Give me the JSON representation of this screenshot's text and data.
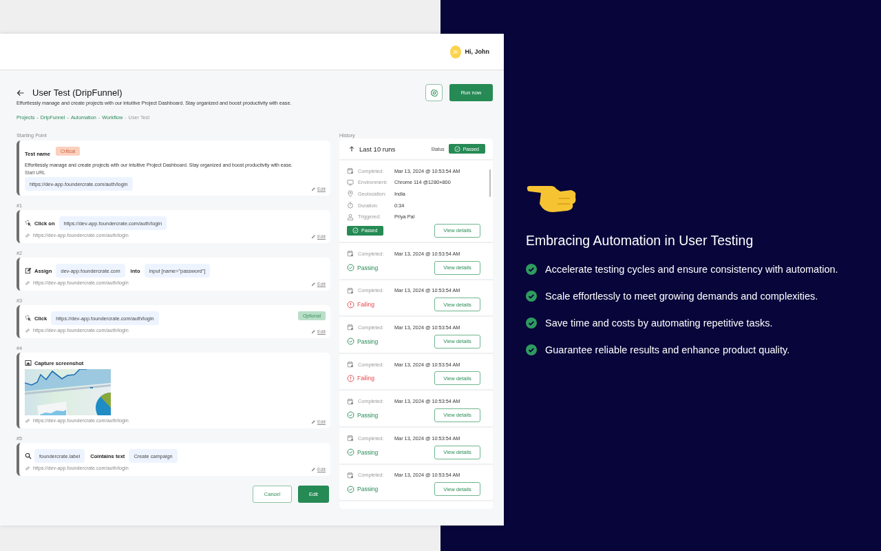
{
  "header": {
    "avatar_initials": "JK",
    "greeting": "Hi, John"
  },
  "page": {
    "title": "User Test (DripFunnel)",
    "description": "Effortlessly manage and create projects with our intuitive Project Dashboard. Stay organized and boost productivity with ease.",
    "separator": "-",
    "breadcrumb": [
      {
        "label": "Projects",
        "link": true
      },
      {
        "label": "DripFunnel",
        "link": true
      },
      {
        "label": "Automation",
        "link": true
      },
      {
        "label": "Workflow",
        "link": true
      },
      {
        "label": "User Test",
        "link": false
      }
    ],
    "run_button": "Run now"
  },
  "starting_point": {
    "heading": "Starting Point",
    "name_label": "Test name",
    "badge": {
      "text": "Critical",
      "kind": "critical"
    },
    "description": "Effortlessly manage and create projects with our intuitive Project Dashboard. Stay organized and boost productivity with ease.",
    "url_label": "Start URL",
    "url": "https://dev-app.foundercrate.com/auth/login",
    "edit": "Edit"
  },
  "steps": [
    {
      "number": "#1",
      "kind": "click",
      "parts": [
        {
          "kind": "label",
          "text": "Click on"
        },
        {
          "kind": "chip",
          "text": "https://dev-app.foundercrate.com/auth/login"
        }
      ],
      "link": "https://dev-app.foundercrate.com/auth/login",
      "edit": "Edit"
    },
    {
      "number": "#2",
      "kind": "assign",
      "parts": [
        {
          "kind": "label",
          "text": "Assign"
        },
        {
          "kind": "chip",
          "text": "dev-app.foundercrate.com"
        },
        {
          "kind": "label",
          "text": "into"
        },
        {
          "kind": "chip",
          "text": "input [name=\"password\"]"
        }
      ],
      "link": "https://dev-app.foundercrate.com/auth/login",
      "edit": "Edit"
    },
    {
      "number": "#3",
      "kind": "click",
      "parts": [
        {
          "kind": "label",
          "text": "Click"
        },
        {
          "kind": "chip",
          "text": "https://dev-app.foundercrate.com/auth/login"
        }
      ],
      "badge": {
        "text": "Optional",
        "kind": "optional"
      },
      "link": "https://dev-app.foundercrate.com/auth/login",
      "edit": "Edit"
    },
    {
      "number": "#4",
      "kind": "screenshot",
      "parts": [
        {
          "kind": "label",
          "text": "Capture screenshot"
        }
      ],
      "screenshot": {
        "kind": "picture"
      },
      "link": "https://dev-app.foundercrate.com/auth/login",
      "edit": "Edit"
    },
    {
      "number": "#5",
      "kind": "find",
      "parts": [
        {
          "kind": "chip",
          "text": "foundercrate.label"
        },
        {
          "kind": "label",
          "text": "Cointains text"
        },
        {
          "kind": "chip",
          "text": "Create campaign"
        }
      ],
      "link": "https://dev-app.foundercrate.com/auth/login",
      "edit": "Edit"
    }
  ],
  "actions": {
    "cancel": "Cancel",
    "submit": "Edit"
  },
  "history": {
    "heading": "History",
    "title": "Last 10 runs",
    "status_label": "Status",
    "status": {
      "text": "Passed",
      "kind": "passed"
    },
    "runs": [
      {
        "details": [
          {
            "kind": "calendar",
            "label": "Completed:",
            "value": "Mar 13, 2024 @ 10:53:54 AM"
          },
          {
            "kind": "monitor",
            "label": "Environment:",
            "value": "Chrome 114 @1280×800"
          },
          {
            "kind": "location",
            "label": "Geolocation:",
            "value": "India"
          },
          {
            "kind": "timer",
            "label": "Duration:",
            "value": "0:34"
          },
          {
            "kind": "user",
            "label": "Triggered:",
            "value": "Priya Pal"
          }
        ],
        "status": {
          "text": "Passed",
          "kind": "passed"
        },
        "button": "View details"
      },
      {
        "details": [
          {
            "kind": "calendar",
            "label": "Completed:",
            "value": "Mar 13, 2024 @ 10:53:54 AM"
          }
        ],
        "status": {
          "text": "Passing",
          "kind": "passing"
        },
        "button": "View details"
      },
      {
        "details": [
          {
            "kind": "calendar",
            "label": "Completed:",
            "value": "Mar 13, 2024 @ 10:53:54 AM"
          }
        ],
        "status": {
          "text": "Failing",
          "kind": "failing"
        },
        "button": "View details"
      },
      {
        "details": [
          {
            "kind": "calendar",
            "label": "Completed:",
            "value": "Mar 13, 2024 @ 10:53:54 AM"
          }
        ],
        "status": {
          "text": "Passing",
          "kind": "passing"
        },
        "button": "View details"
      },
      {
        "details": [
          {
            "kind": "calendar",
            "label": "Completed:",
            "value": "Mar 13, 2024 @ 10:53:54 AM"
          }
        ],
        "status": {
          "text": "Failing",
          "kind": "failing"
        },
        "button": "View details"
      },
      {
        "details": [
          {
            "kind": "calendar",
            "label": "Completed:",
            "value": "Mar 13, 2024 @ 10:53:54 AM"
          }
        ],
        "status": {
          "text": "Passing",
          "kind": "passing"
        },
        "button": "View details"
      },
      {
        "details": [
          {
            "kind": "calendar",
            "label": "Completed:",
            "value": "Mar 13, 2024 @ 10:53:54 AM"
          }
        ],
        "status": {
          "text": "Passing",
          "kind": "passing"
        },
        "button": "View details"
      },
      {
        "details": [
          {
            "kind": "calendar",
            "label": "Completed:",
            "value": "Mar 13, 2024 @ 10:53:54 AM"
          }
        ],
        "status": {
          "text": "Passing",
          "kind": "passing"
        },
        "button": "View details"
      }
    ]
  },
  "promo": {
    "title": "Embracing Automation in User Testing",
    "points": [
      "Accelerate testing cycles and ensure consistency with automation.",
      "Scale effortlessly to meet growing demands and complexities.",
      "Save time and costs by automating repetitive tasks.",
      "Guarantee reliable results and enhance product quality."
    ]
  }
}
